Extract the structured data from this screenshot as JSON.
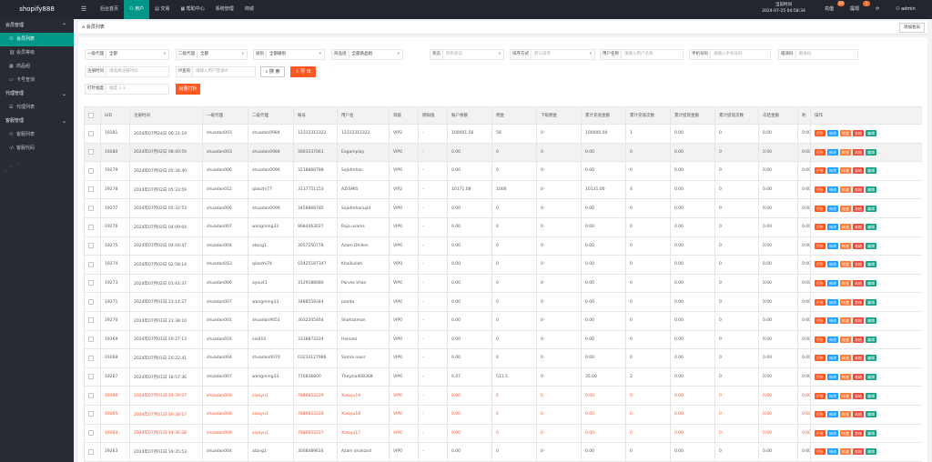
{
  "app": {
    "logo": "shopify888"
  },
  "topnav": [
    "后台首页",
    "用户",
    "交易",
    "帮助中心",
    "系统管理",
    "商城"
  ],
  "topright": {
    "server_time_label": "当前时间",
    "server_time": "2024-07-25 04:58:34",
    "recharge_label": "充值",
    "recharge_badge": "19",
    "withdraw_label": "提现",
    "withdraw_badge": "1",
    "user": "admin"
  },
  "sidebar": {
    "group1": "会员管理",
    "group1_items": [
      "会员列表",
      "会员等级",
      "商品组",
      "卡号查询"
    ],
    "group2": "代理管理",
    "group2_items": [
      "代理列表"
    ],
    "group3": "客服管理",
    "group3_items": [
      "客服列表",
      "客服代码"
    ]
  },
  "tab": {
    "label": "会员列表",
    "add_button": "添加会员"
  },
  "filters": {
    "agent1": {
      "label": "一级代理",
      "value": "全部"
    },
    "agent2": {
      "label": "二级代理",
      "value": "全部"
    },
    "level": {
      "label": "级别",
      "value": "全部级别"
    },
    "group": {
      "label": "商品组",
      "value": "全部商品组"
    },
    "status": {
      "label": "状态",
      "placeholder": "所有状态"
    },
    "sort": {
      "label": "排序方式",
      "placeholder": "默认排序"
    },
    "username": {
      "label": "用户名称",
      "placeholder": "请输入用户名称"
    },
    "phone": {
      "label": "手机号码",
      "placeholder": "请输入手机号码"
    },
    "invite": {
      "label": "邀请码",
      "placeholder": "邀请码"
    },
    "regtime": {
      "label": "注册时间",
      "placeholder": "请选择注册时间"
    },
    "ip": {
      "label": "IP查询",
      "placeholder": "请输入用户登录IP"
    },
    "interval": {
      "label": "打针幅度",
      "placeholder": "幅度 1-3"
    },
    "search_button": "搜 索",
    "export_button": "导 出",
    "batch_button": "批量打针"
  },
  "table": {
    "headers": [
      "UID",
      "注册时间",
      "一级代理",
      "二级代理",
      "账号",
      "用户名",
      "等级",
      "阴阳值",
      "账户余额",
      "佣金",
      "下级佣金",
      "累计充值金额",
      "累计充值次数",
      "累计提现金额",
      "累计提现次数",
      "冻结金额",
      "利",
      "操作"
    ],
    "actions": [
      "打针",
      "修改",
      "帐变",
      "冻结",
      "编辑"
    ],
    "more": "…",
    "rows": [
      [
        "19281",
        "2024年07月24日 06:31:19",
        "shuadan003",
        "shuadan0984",
        "12312312322",
        "12312312322",
        "VIP2",
        "-",
        "100001.56",
        "58",
        "0",
        "100000.00",
        "1",
        "0.00",
        "0",
        "0.00",
        "0.00"
      ],
      [
        "19280",
        "2024年07月02日 08:40:59",
        "shuadan003",
        "shuadan0984",
        "3003337061",
        "Eagamplay",
        "VIP0",
        "-",
        "0.00",
        "0",
        "0",
        "0.00",
        "0",
        "0.00",
        "0",
        "0.00",
        "0.00"
      ],
      [
        "19279",
        "2024年07月02日 05:34:40",
        "shuadan006",
        "shuadan0096",
        "3218868788",
        "Sajidrehan",
        "VIP0",
        "-",
        "0.00",
        "0",
        "0",
        "0.00",
        "0",
        "0.00",
        "0",
        "0.00",
        "0.00"
      ],
      [
        "19278",
        "2024年07月02日 05:33:59",
        "shuadan012",
        "qiaozhi77",
        "3137751153",
        "AZISMIS",
        "VIP2",
        "-",
        "10171.08",
        "1006",
        "0",
        "10131.00",
        "4",
        "0.00",
        "0",
        "0.00",
        "0.00"
      ],
      [
        "19277",
        "2024年07月02日 05:32:53",
        "shuadan006",
        "shuadan0096",
        "3456868785",
        "Sajidrehanujid",
        "VIP0",
        "-",
        "0.00",
        "0",
        "0",
        "0.00",
        "0",
        "0.00",
        "0",
        "0.00",
        "0.00"
      ],
      [
        "19276",
        "2024年07月02日 04:09:04",
        "shuadan007",
        "wangming33",
        "9684463027",
        "Raja usams",
        "VIP0",
        "-",
        "0.00",
        "0",
        "0",
        "0.00",
        "0",
        "0.00",
        "0",
        "0.00",
        "0.00"
      ],
      [
        "19275",
        "2024年07月02日 04:04:47",
        "shuadan004",
        "atong1",
        "3057250778",
        "Azam Dhillon",
        "VIP0",
        "-",
        "0.00",
        "0",
        "0",
        "0.00",
        "0",
        "0.00",
        "0",
        "0.00",
        "0.00"
      ],
      [
        "19274",
        "2024年07月02日 02:58:14",
        "shuadan012",
        "qiaozhi74",
        "03425187347",
        "Khalilullah",
        "VIP0",
        "-",
        "0.00",
        "0",
        "0",
        "0.00",
        "0",
        "0.00",
        "0",
        "0.00",
        "0.00"
      ],
      [
        "19273",
        "2024年07月02日 01:41:37",
        "shuadan006",
        "ayou41",
        "3129188080",
        "Parvez khan",
        "VIP0",
        "-",
        "0.00",
        "0",
        "0",
        "0.00",
        "0",
        "0.00",
        "0",
        "0.00",
        "0.00"
      ],
      [
        "19271",
        "2024年07月01日 23:14:27",
        "shuadan007",
        "wangming33",
        "3488559344",
        "panda",
        "VIP0",
        "-",
        "0.00",
        "0",
        "0",
        "0.00",
        "0",
        "0.00",
        "0",
        "0.00",
        "0.00"
      ],
      [
        "19270",
        "2024年07月01日 21:38:10",
        "shuadan001",
        "shuadan9051",
        "3032205464",
        "Shahzaman",
        "VIP0",
        "-",
        "0.00",
        "0",
        "0",
        "0.00",
        "0",
        "0.00",
        "0",
        "0.00",
        "0.00"
      ],
      [
        "19269",
        "2024年07月01日 20:27:13",
        "shuadan016",
        "xia010",
        "3338873224",
        "Hanomi",
        "VIP0",
        "-",
        "0.00",
        "0",
        "0",
        "0.00",
        "0",
        "0.00",
        "0",
        "0.00",
        "0.00"
      ],
      [
        "19268",
        "2024年07月01日 20:22:41",
        "shuadan004",
        "shuadan0070",
        "03214127986",
        "Samia nasir",
        "VIP0",
        "-",
        "0.00",
        "0",
        "0",
        "0.00",
        "0",
        "0.00",
        "0",
        "0.00",
        "0.00"
      ],
      [
        "19267",
        "2024年07月01日 18:57:36",
        "shuadan007",
        "wangming33",
        "770836800",
        "Theyzia408368",
        "VIP0",
        "-",
        "0.47",
        "511.5",
        "0",
        "35.00",
        "2",
        "0.00",
        "0",
        "0.00",
        "0.00"
      ],
      [
        "19266",
        "2024年07月01日 19:39:07",
        "shuadan008",
        "xiaoyu1",
        "7886653229",
        "Xiaoyu19",
        "VIP0",
        "-",
        "0.00",
        "0",
        "0",
        "0.00",
        "0",
        "0.00",
        "0",
        "0.00",
        "0.00"
      ],
      [
        "19265",
        "2024年07月01日 19:38:17",
        "shuadan008",
        "xiaoyu1",
        "7886653228",
        "Xiaoyu18",
        "VIP0",
        "-",
        "0.00",
        "0",
        "0",
        "0.00",
        "0",
        "0.00",
        "0",
        "0.00",
        "0.00"
      ],
      [
        "19264",
        "2024年07月01日 19:36:38",
        "shuadan008",
        "xiaoyu1",
        "7886653227",
        "Xiaoyu17",
        "VIP0",
        "-",
        "0.00",
        "0",
        "0",
        "0.00",
        "0",
        "0.00",
        "0",
        "0.00",
        "0.00"
      ],
      [
        "19263",
        "2024年07月01日 19:35:53",
        "shuadan004",
        "atong1",
        "3008489616",
        "Azam shahzad",
        "VIP0",
        "-",
        "0.00",
        "0",
        "0",
        "0.00",
        "0",
        "0.00",
        "0",
        "0.00",
        "0.00"
      ]
    ],
    "red_rows": [
      14,
      15,
      16
    ],
    "highlight_rows": [
      1
    ]
  },
  "colors": {
    "accent": "#009688",
    "orange": "#ff5722",
    "red_text": "#ff4d2b",
    "dark": "#23262e"
  }
}
